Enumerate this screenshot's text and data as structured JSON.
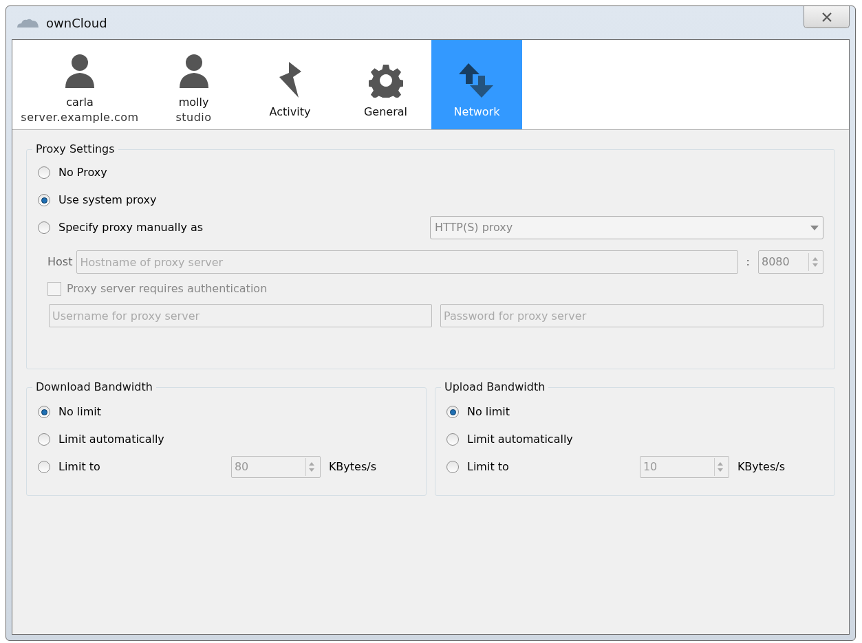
{
  "window": {
    "title": "ownCloud"
  },
  "tabs": [
    {
      "kind": "account",
      "label": "carla",
      "sublabel": "server.example.com",
      "selected": false
    },
    {
      "kind": "account",
      "label": "molly",
      "sublabel": "studio",
      "selected": false
    },
    {
      "kind": "activity",
      "label": "Activity",
      "selected": false
    },
    {
      "kind": "general",
      "label": "General",
      "selected": false
    },
    {
      "kind": "network",
      "label": "Network",
      "selected": true
    }
  ],
  "proxy": {
    "title": "Proxy Settings",
    "options": [
      {
        "label": "No Proxy",
        "selected": false
      },
      {
        "label": "Use system proxy",
        "selected": true
      },
      {
        "label": "Specify proxy manually as",
        "selected": false
      }
    ],
    "proxy_type": {
      "value": "HTTP(S) proxy",
      "disabled": true
    },
    "host_label": "Host",
    "host_placeholder": "Hostname of proxy server",
    "port_separator": ":",
    "port": "8080",
    "auth": {
      "label": "Proxy server requires authentication",
      "checked": false,
      "disabled": true
    },
    "username_placeholder": "Username for proxy server",
    "password_placeholder": "Password for proxy server"
  },
  "bandwidth": [
    {
      "title": "Download Bandwidth",
      "options": [
        {
          "kind": "radio",
          "label": "No limit",
          "selected": true
        },
        {
          "kind": "radio",
          "label": "Limit automatically",
          "selected": false
        },
        {
          "kind": "limit",
          "label": "Limit to",
          "selected": false,
          "value": "80",
          "unit": "KBytes/s"
        }
      ]
    },
    {
      "title": "Upload Bandwidth",
      "options": [
        {
          "kind": "radio",
          "label": "No limit",
          "selected": true
        },
        {
          "kind": "radio",
          "label": "Limit automatically",
          "selected": false
        },
        {
          "kind": "limit",
          "label": "Limit to",
          "selected": false,
          "value": "10",
          "unit": "KBytes/s"
        }
      ]
    }
  ]
}
